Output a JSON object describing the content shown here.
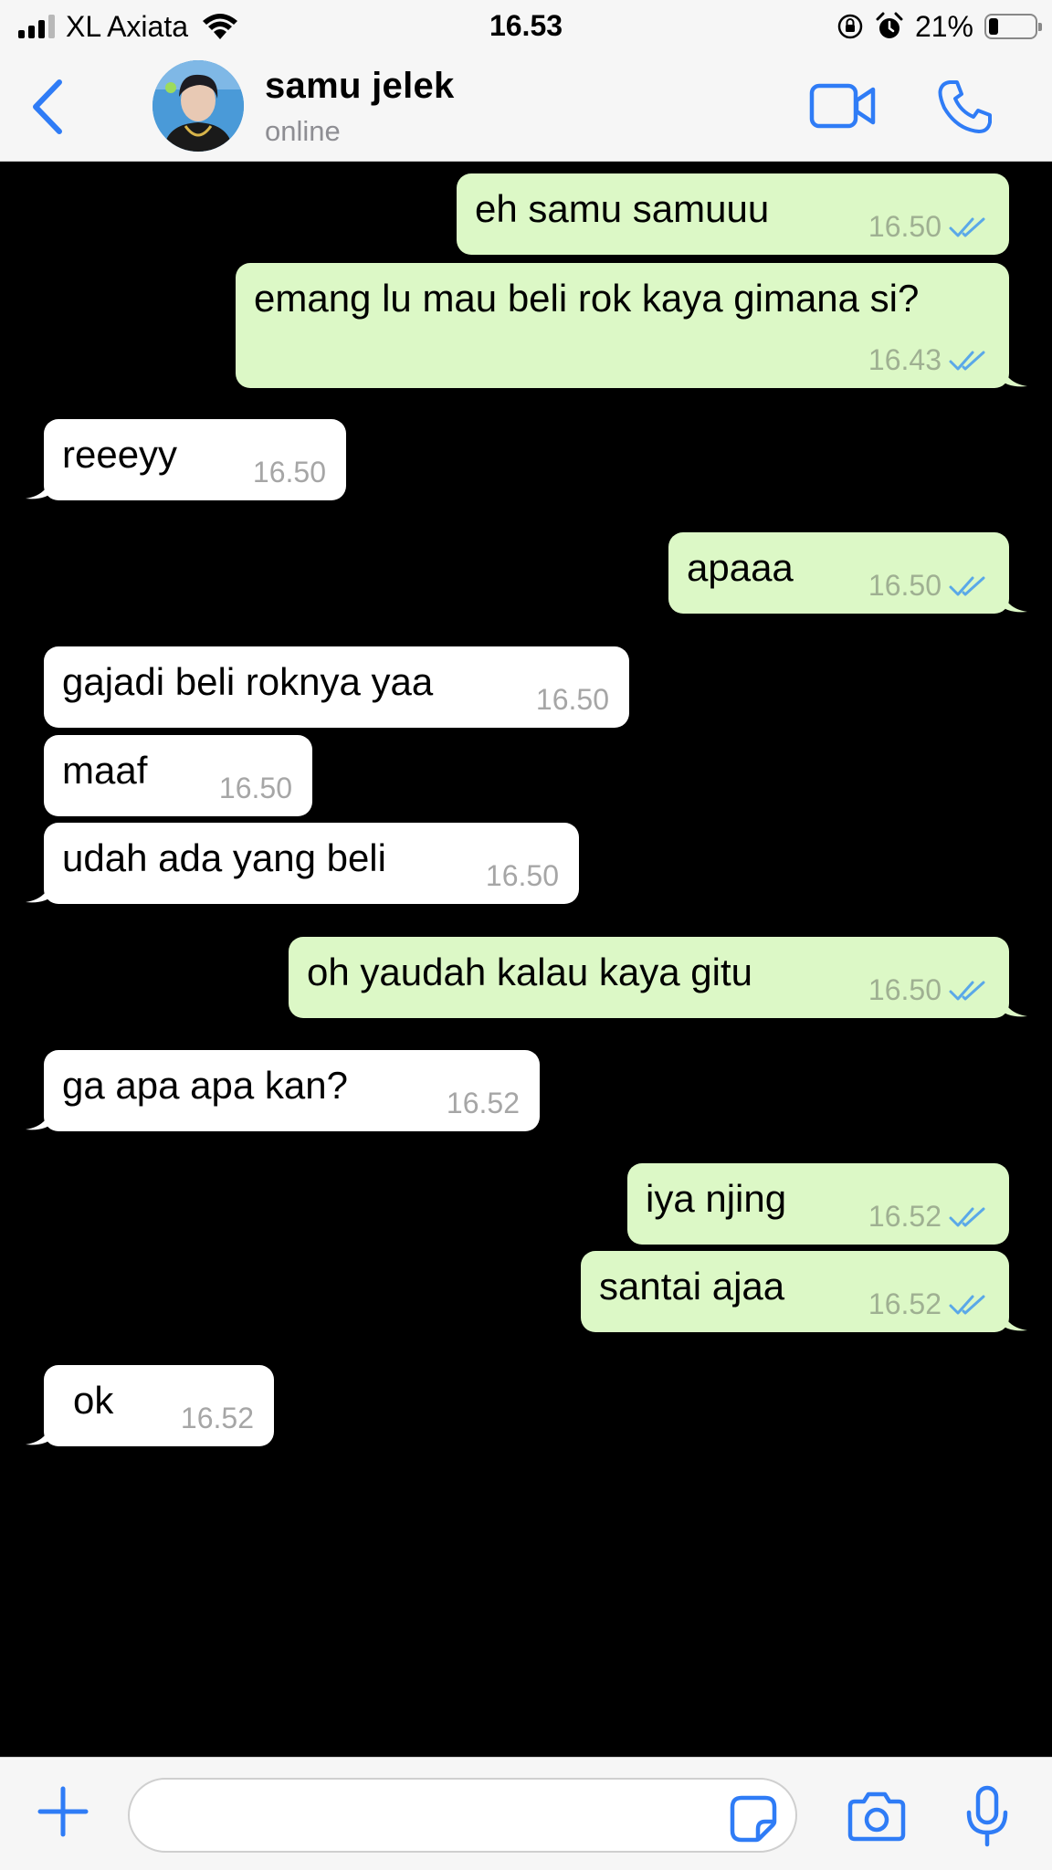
{
  "status_bar": {
    "carrier": "XL Axiata",
    "time": "16.53",
    "battery_percent": "21%",
    "battery_level": 0.21,
    "signal_bars_active": 3,
    "signal_bars_total": 4,
    "icons": [
      "wifi-icon",
      "rotation-lock-icon",
      "alarm-icon"
    ]
  },
  "header": {
    "back_icon": "chevron-left-icon",
    "contact_name": "samu jelek",
    "contact_status": "online",
    "video_icon": "video-camera-icon",
    "call_icon": "phone-icon"
  },
  "colors": {
    "accent": "#2f7cf6",
    "incoming_bubble": "#ffffff",
    "outgoing_bubble": "#dcf8c6",
    "chat_background": "#000000",
    "read_ticks": "#5aa8e8"
  },
  "messages": [
    {
      "direction": "out",
      "text": "eh samu samuuu",
      "time": "16.50",
      "status": "read"
    },
    {
      "direction": "out",
      "text": "emang lu mau beli rok kaya gimana si?",
      "time": "16.43",
      "status": "read"
    },
    {
      "direction": "in",
      "text": "reeeyy",
      "time": "16.50"
    },
    {
      "direction": "out",
      "text": "apaaa",
      "time": "16.50",
      "status": "read"
    },
    {
      "direction": "in",
      "text": "gajadi beli roknya yaa",
      "time": "16.50"
    },
    {
      "direction": "in",
      "text": "maaf",
      "time": "16.50"
    },
    {
      "direction": "in",
      "text": "udah ada yang beli",
      "time": "16.50"
    },
    {
      "direction": "out",
      "text": "oh yaudah kalau kaya gitu",
      "time": "16.50",
      "status": "read"
    },
    {
      "direction": "in",
      "text": "ga apa apa kan?",
      "time": "16.52"
    },
    {
      "direction": "out",
      "text": "iya njing",
      "time": "16.52",
      "status": "read"
    },
    {
      "direction": "out",
      "text": "santai ajaa",
      "time": "16.52",
      "status": "read"
    },
    {
      "direction": "in",
      "text": "ok",
      "time": "16.52"
    }
  ],
  "input_bar": {
    "value": "",
    "placeholder": "",
    "icons": [
      "plus-icon",
      "sticker-icon",
      "camera-icon",
      "microphone-icon"
    ]
  }
}
